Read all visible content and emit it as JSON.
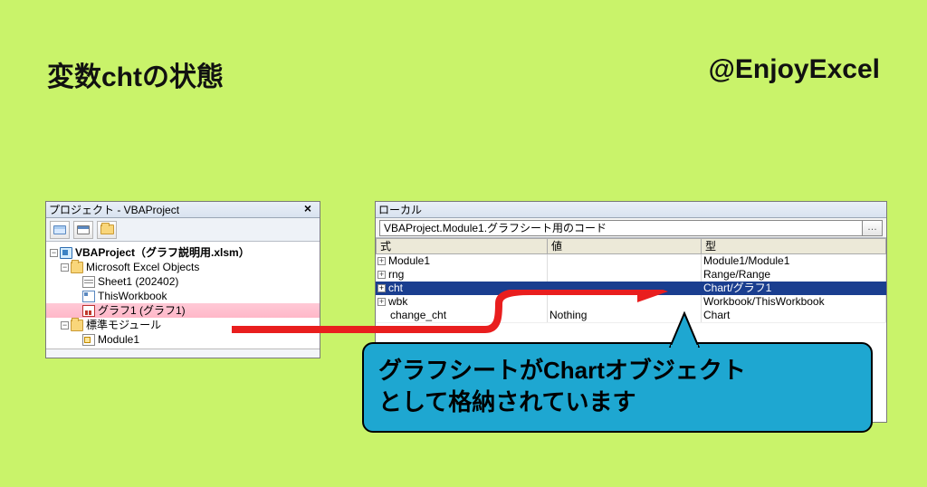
{
  "header": {
    "left_title": "変数chtの状態",
    "right_title": "@EnjoyExcel"
  },
  "project_explorer": {
    "title": "プロジェクト - VBAProject",
    "close_label": "×",
    "root": "VBAProject（グラフ説明用.xlsm）",
    "excel_objects_label": "Microsoft Excel Objects",
    "sheet1": "Sheet1 (202402)",
    "thisworkbook": "ThisWorkbook",
    "chart1": "グラフ1 (グラフ1)",
    "std_modules_label": "標準モジュール",
    "module1": "Module1"
  },
  "locals": {
    "title": "ローカル",
    "context": "VBAProject.Module1.グラフシート用のコード",
    "headers": {
      "expr": "式",
      "value": "値",
      "type": "型"
    },
    "rows": [
      {
        "expr": "Module1",
        "value": "",
        "type": "Module1/Module1",
        "expandable": true
      },
      {
        "expr": "rng",
        "value": "",
        "type": "Range/Range",
        "expandable": true
      },
      {
        "expr": "cht",
        "value": "",
        "type": "Chart/グラフ1",
        "expandable": true,
        "selected": true
      },
      {
        "expr": "wbk",
        "value": "",
        "type": "Workbook/ThisWorkbook",
        "expandable": true
      },
      {
        "expr": "change_cht",
        "value": "Nothing",
        "type": "Chart",
        "expandable": false
      }
    ]
  },
  "annotation": {
    "line1": "グラフシートがChartオブジェクト",
    "line2": "として格納されています"
  }
}
